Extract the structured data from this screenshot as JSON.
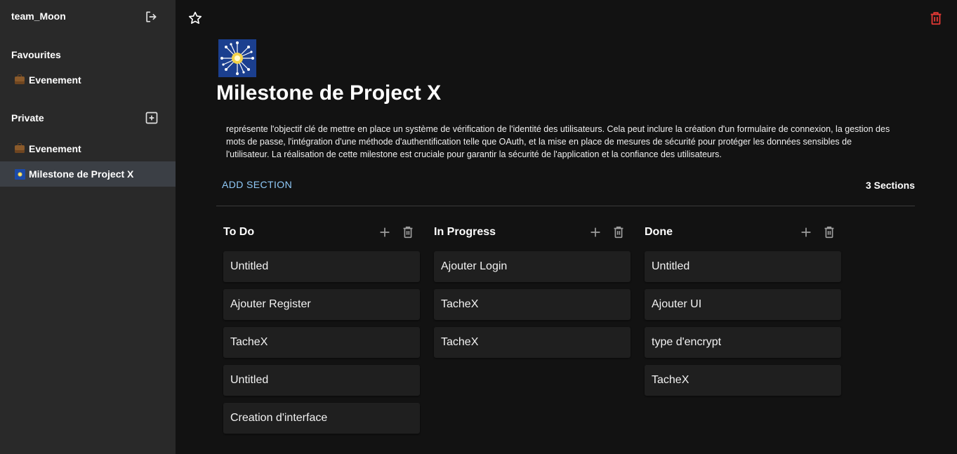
{
  "sidebar": {
    "team_name": "team_Moon",
    "favourites_title": "Favourites",
    "favourites": [
      {
        "icon": "briefcase-icon",
        "label": "Evenement"
      }
    ],
    "private_title": "Private",
    "private": [
      {
        "icon": "briefcase-icon",
        "label": "Evenement"
      },
      {
        "icon": "fireworks-icon",
        "label": "Milestone de Project X",
        "active": true
      }
    ]
  },
  "page": {
    "title": "Milestone de Project X",
    "description": "représente l'objectif clé de mettre en place un système de vérification de l'identité des utilisateurs. Cela peut inclure la création d'un formulaire de connexion, la gestion des mots de passe, l'intégration d'une méthode d'authentification telle que OAuth, et la mise en place de mesures de sécurité pour protéger les données sensibles de l'utilisateur. La réalisation de cette milestone est cruciale pour garantir la sécurité de l'application et la confiance des utilisateurs.",
    "add_section_label": "ADD SECTION",
    "section_count": "3 Sections"
  },
  "board": {
    "columns": [
      {
        "title": "To Do",
        "cards": [
          "Untitled",
          "Ajouter Register",
          "TacheX",
          "Untitled",
          "Creation d'interface"
        ]
      },
      {
        "title": "In Progress",
        "cards": [
          "Ajouter Login",
          "TacheX",
          "TacheX"
        ]
      },
      {
        "title": "Done",
        "cards": [
          "Untitled",
          "Ajouter UI",
          "type d'encrypt",
          "TacheX"
        ]
      }
    ]
  },
  "colors": {
    "sidebar_bg": "#292929",
    "main_bg": "#121212",
    "active_item": "#3b3f45",
    "accent": "#90caf9",
    "danger": "#e53935"
  }
}
